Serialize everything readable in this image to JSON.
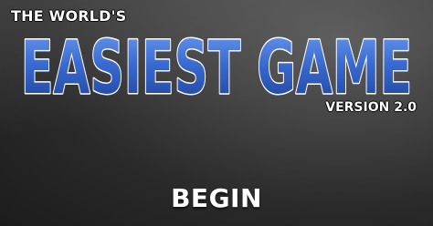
{
  "title_screen": {
    "subtitle": "THE WORLD'S",
    "title": "EASIEST GAME",
    "version": "VERSION 2.0",
    "begin_label": "BEGIN"
  },
  "colors": {
    "title_fill_top": "#5a88e0",
    "title_fill_bottom": "#1f4aa8",
    "title_outline": "#ffffff",
    "text": "#ffffff",
    "background_dark": "#1c1c1c",
    "background_light": "#5b5b5b"
  }
}
